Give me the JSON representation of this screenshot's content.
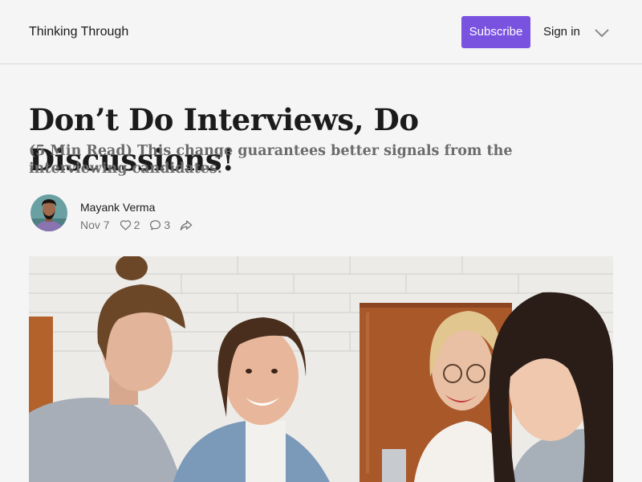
{
  "header": {
    "publication_name": "Thinking Through",
    "subscribe_label": "Subscribe",
    "signin_label": "Sign in"
  },
  "post": {
    "title": "Don’t Do Interviews, Do Discussions!",
    "subtitle": "(5 Min Read) This change guarantees better signals from the interviewing candidates.",
    "author": "Mayank Verma",
    "date": "Nov 7",
    "likes": "2",
    "comments": "3"
  },
  "colors": {
    "accent": "#7a52e0",
    "background": "#f5f5f5",
    "text": "#1b1b1b",
    "muted": "#757575"
  },
  "icons": {
    "like": "heart-icon",
    "comment": "comment-icon",
    "share": "share-icon",
    "menu": "chevron-down-icon"
  }
}
